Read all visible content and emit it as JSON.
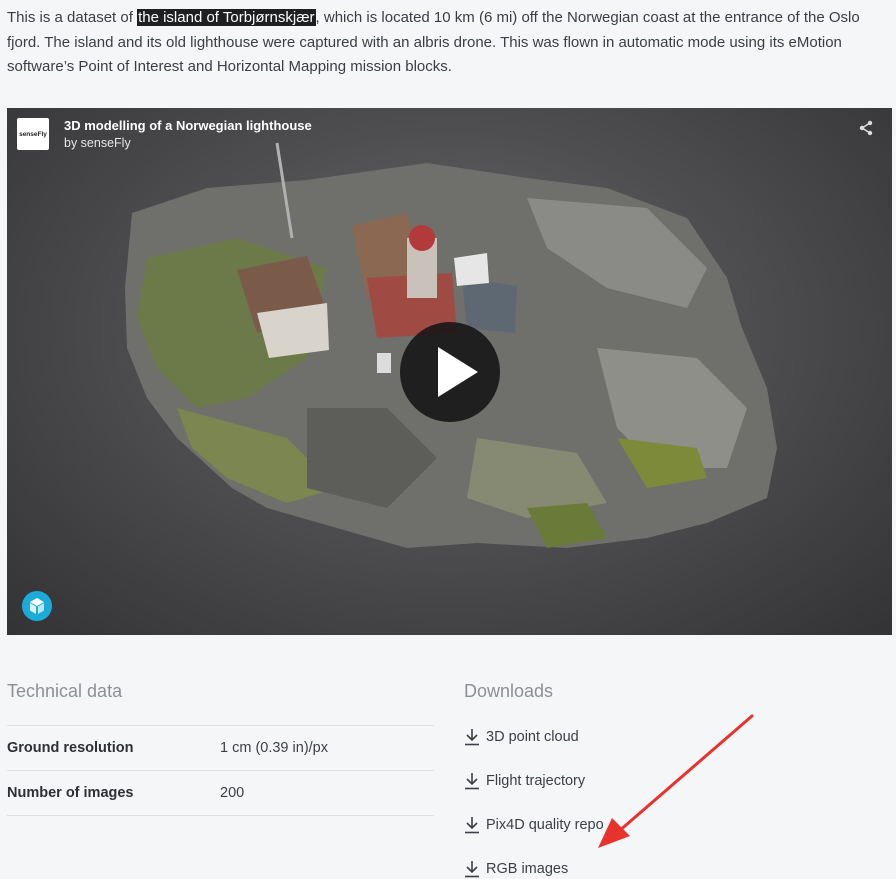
{
  "intro": {
    "before": "This is a dataset of ",
    "highlight": "the island of Torbjørnskjær",
    "after": ", which is located 10 km (6 mi) off the Norwegian coast at the entrance of the Oslo fjord. The island and its old lighthouse were captured with an albris drone. This was flown in automatic mode using its eMotion software’s Point of Interest and Horizontal Mapping mission blocks."
  },
  "viewer": {
    "logo_text": "senseFly",
    "title": "3D modelling of a Norwegian lighthouse",
    "byline": "by senseFly",
    "share_icon": "share-icon",
    "play_icon": "play-icon",
    "badge_icon": "sketchfab-icon"
  },
  "technical": {
    "title": "Technical data",
    "rows": [
      {
        "label": "Ground resolution",
        "value": "1 cm (0.39 in)/px"
      },
      {
        "label": "Number of images",
        "value": "200"
      }
    ]
  },
  "downloads": {
    "title": "Downloads",
    "items": [
      {
        "label": "3D point cloud",
        "icon": "download-icon"
      },
      {
        "label": "Flight trajectory",
        "icon": "download-icon"
      },
      {
        "label": "Pix4D quality repo",
        "icon": "download-icon"
      },
      {
        "label": "RGB images",
        "icon": "download-icon"
      }
    ]
  },
  "colors": {
    "annotation_arrow": "#e8322d",
    "badge": "#1caad9",
    "highlight_bg": "#1e1f21"
  }
}
